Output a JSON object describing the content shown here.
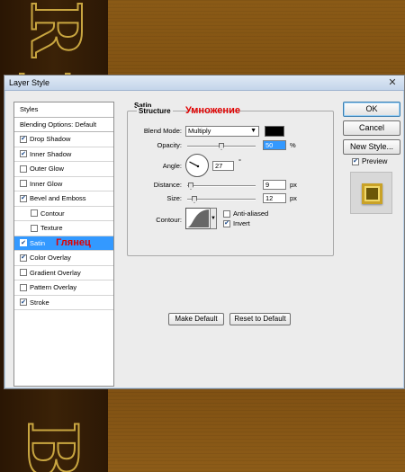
{
  "dialog": {
    "title": "Layer Style",
    "close_glyph": "✕"
  },
  "styles_list": {
    "header": "Styles",
    "blending": "Blending Options: Default",
    "items": [
      {
        "label": "Drop Shadow",
        "checked": true,
        "indent": false
      },
      {
        "label": "Inner Shadow",
        "checked": true,
        "indent": false
      },
      {
        "label": "Outer Glow",
        "checked": false,
        "indent": false
      },
      {
        "label": "Inner Glow",
        "checked": false,
        "indent": false
      },
      {
        "label": "Bevel and Emboss",
        "checked": true,
        "indent": false
      },
      {
        "label": "Contour",
        "checked": false,
        "indent": true
      },
      {
        "label": "Texture",
        "checked": false,
        "indent": true
      },
      {
        "label": "Satin",
        "checked": true,
        "indent": false,
        "selected": true
      },
      {
        "label": "Color Overlay",
        "checked": true,
        "indent": false
      },
      {
        "label": "Gradient Overlay",
        "checked": false,
        "indent": false
      },
      {
        "label": "Pattern Overlay",
        "checked": false,
        "indent": false
      },
      {
        "label": "Stroke",
        "checked": true,
        "indent": false
      }
    ]
  },
  "annotations": {
    "satin": "Глянец",
    "blend": "Умножение"
  },
  "satin": {
    "title": "Satin",
    "structure_title": "Structure",
    "blend_mode_label": "Blend Mode:",
    "blend_mode_value": "Multiply",
    "blend_color": "#000000",
    "opacity_label": "Opacity:",
    "opacity_value": "50",
    "opacity_unit": "%",
    "angle_label": "Angle:",
    "angle_value": "27",
    "angle_unit": "°",
    "distance_label": "Distance:",
    "distance_value": "9",
    "distance_unit": "px",
    "size_label": "Size:",
    "size_value": "12",
    "size_unit": "px",
    "contour_label": "Contour:",
    "anti_aliased_label": "Anti-aliased",
    "anti_aliased_checked": false,
    "invert_label": "Invert",
    "invert_checked": true,
    "make_default": "Make Default",
    "reset_default": "Reset to Default"
  },
  "buttons": {
    "ok": "OK",
    "cancel": "Cancel",
    "new_style": "New Style...",
    "preview_label": "Preview",
    "preview_checked": true
  },
  "colors": {
    "selection": "#3399ff",
    "annotation": "#e00000"
  }
}
